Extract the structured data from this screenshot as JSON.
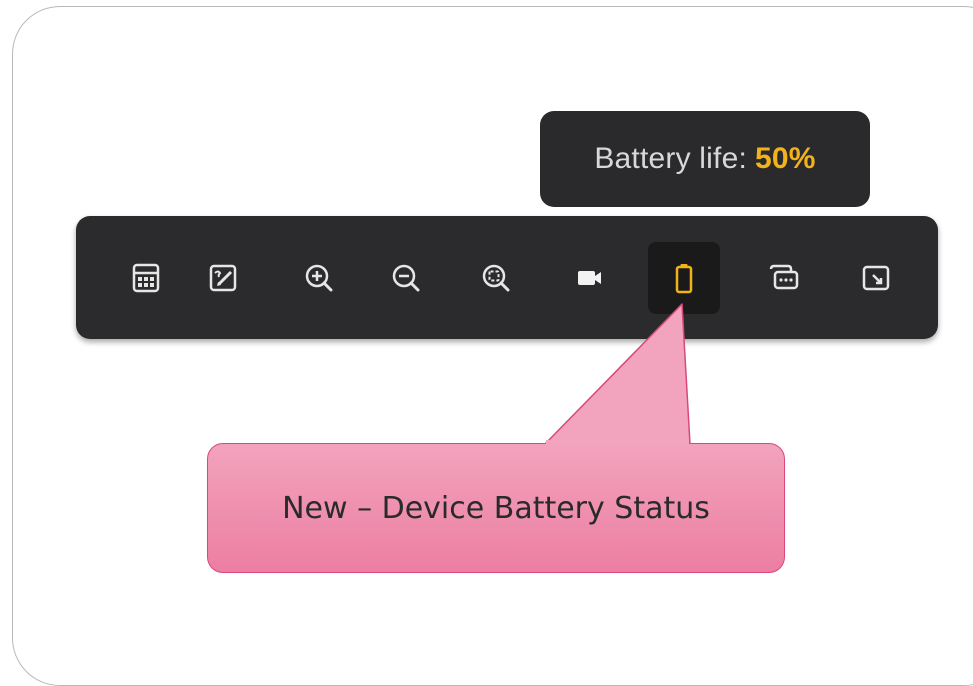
{
  "tooltip": {
    "label": "Battery life:",
    "value": "50%",
    "value_color": "#f2b21b"
  },
  "toolbar": {
    "items": [
      {
        "icon": "calculator-icon"
      },
      {
        "icon": "edit-icon"
      },
      {
        "icon": "zoom-in-icon"
      },
      {
        "icon": "zoom-out-icon"
      },
      {
        "icon": "zoom-fit-icon"
      },
      {
        "icon": "video-camera-icon"
      },
      {
        "icon": "battery-icon",
        "active": true,
        "level": 0.5
      },
      {
        "icon": "chat-icon"
      },
      {
        "icon": "picture-in-picture-icon"
      }
    ]
  },
  "callout": {
    "text": "New – Device Battery Status",
    "fill_color": "#f08db0",
    "border_color": "#d9487a"
  }
}
